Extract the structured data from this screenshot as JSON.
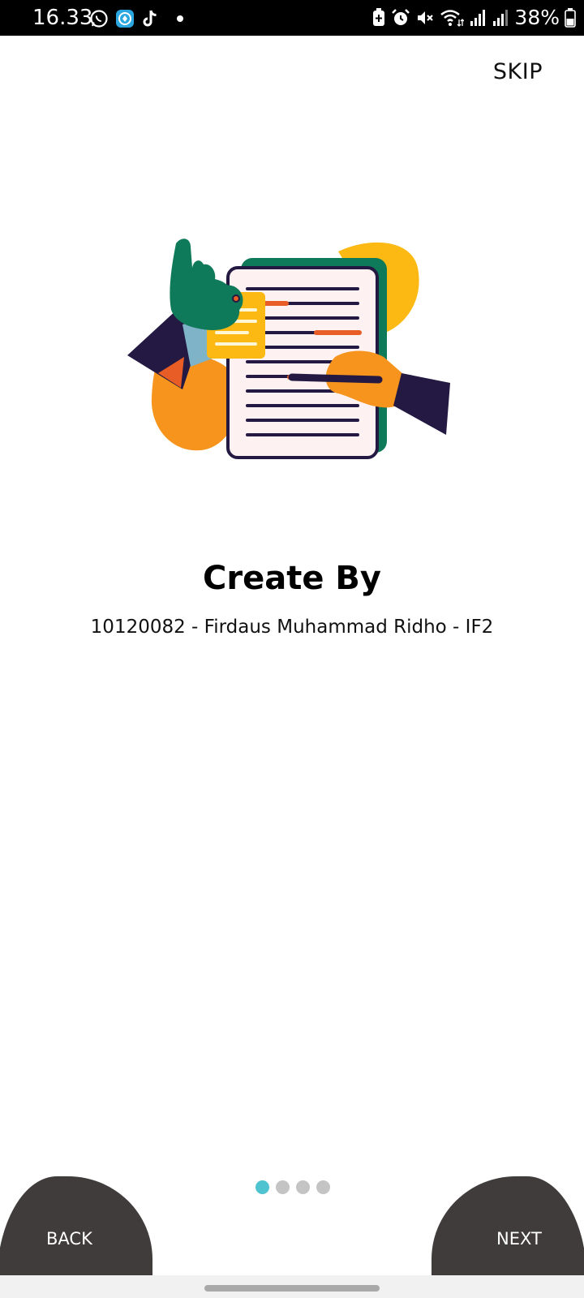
{
  "status_bar": {
    "time": "16.33",
    "battery": "38%",
    "icons": [
      "whatsapp-icon",
      "app-icon",
      "tiktok-icon",
      "notification-dot",
      "battery-saver-icon",
      "alarm-icon",
      "mute-icon",
      "wifi-icon",
      "signal-icon",
      "signal-icon-2",
      "battery-icon"
    ]
  },
  "header": {
    "skip_label": "SKIP"
  },
  "content": {
    "illustration": "document-checklist-illustration",
    "title": "Create By",
    "subtitle": "10120082 - Firdaus Muhammad Ridho - IF2"
  },
  "pager": {
    "count": 4,
    "active_index": 0
  },
  "footer": {
    "back_label": "BACK",
    "next_label": "NEXT"
  },
  "colors": {
    "accent": "#4fc3cf",
    "button_bg": "#403c3c",
    "illus_green": "#0f7a5a",
    "illus_orange": "#f7941d",
    "illus_yellow": "#fdb913",
    "illus_navy": "#231942"
  }
}
